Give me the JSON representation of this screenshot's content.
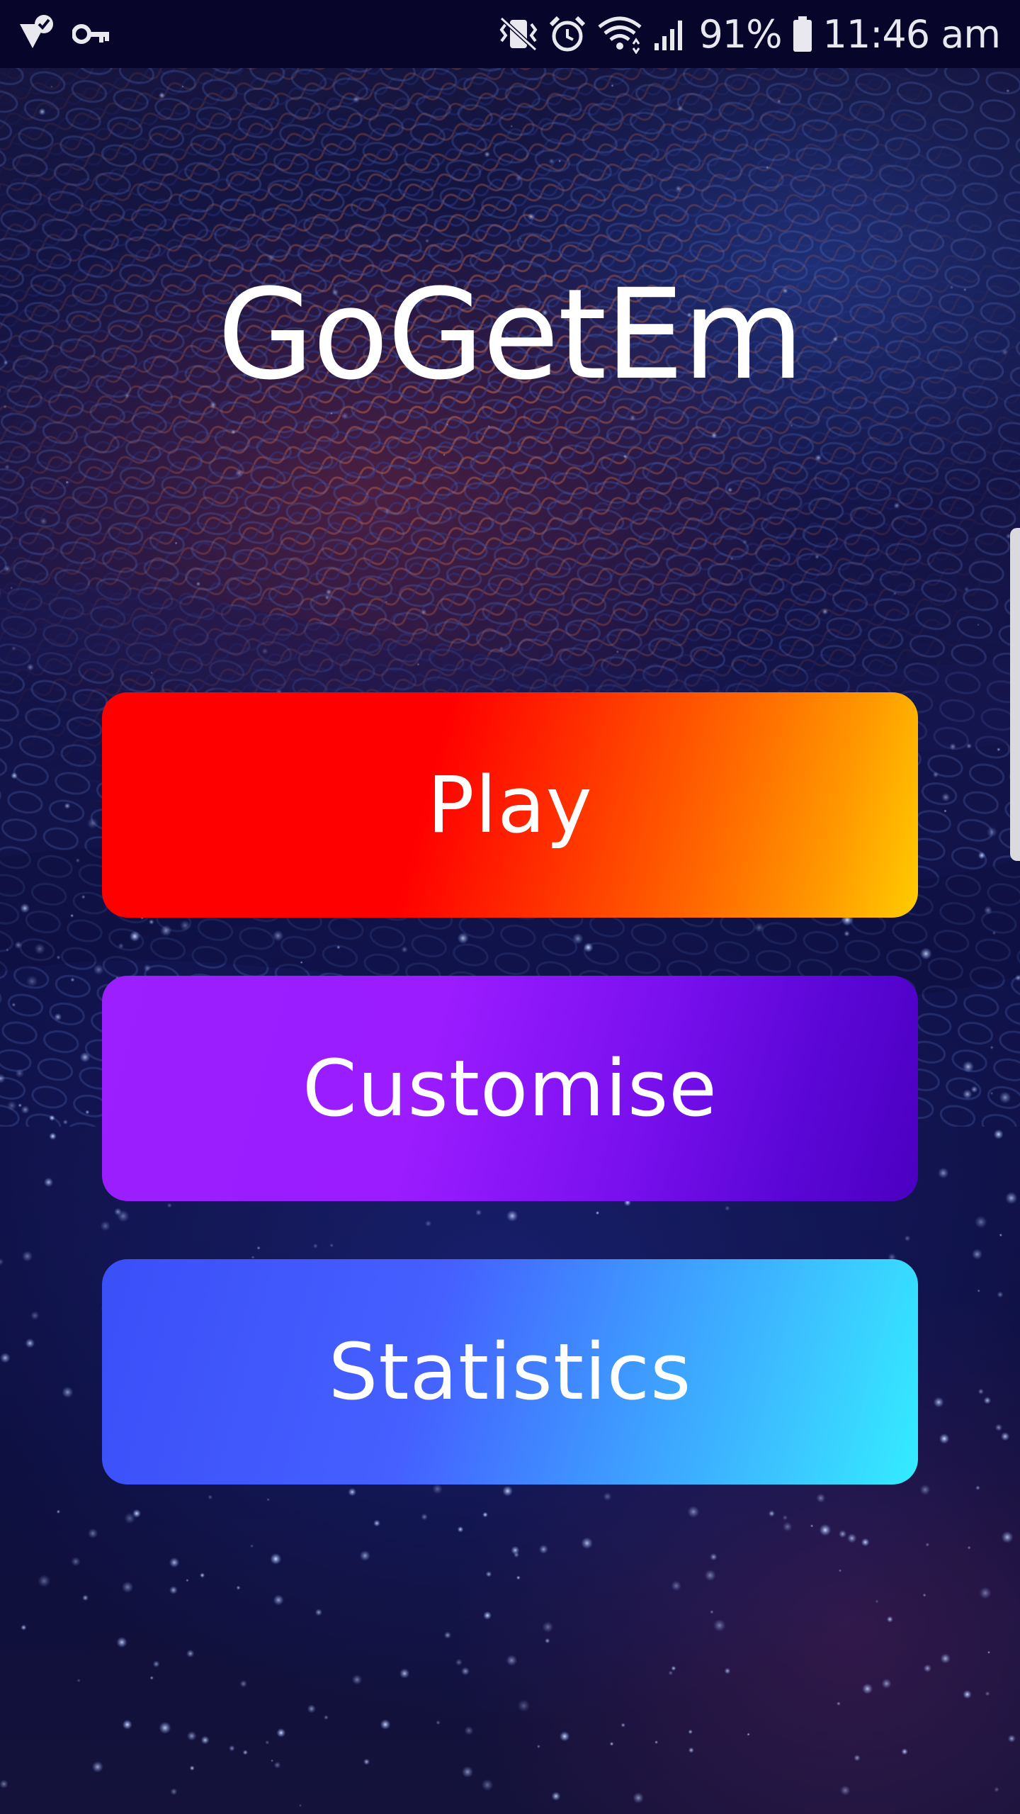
{
  "status_bar": {
    "left_icons": [
      "notification-check-icon",
      "key-icon"
    ],
    "right_icons": [
      "vibrate-icon",
      "alarm-icon",
      "wifi-icon",
      "signal-icon"
    ],
    "battery_percent": "91%",
    "time": "11:46 am",
    "background_color": "#07062a"
  },
  "app": {
    "title": "GoGetEm",
    "buttons": {
      "play": "Play",
      "customise": "Customise",
      "statistics": "Statistics"
    }
  },
  "colors": {
    "play_gradient": [
      "#ff0000",
      "#ffcc00"
    ],
    "customise_gradient": [
      "#9b1fff",
      "#4b00c0"
    ],
    "statistics_gradient": [
      "#3b4ff8",
      "#33ecff"
    ],
    "text": "#ffffff"
  }
}
